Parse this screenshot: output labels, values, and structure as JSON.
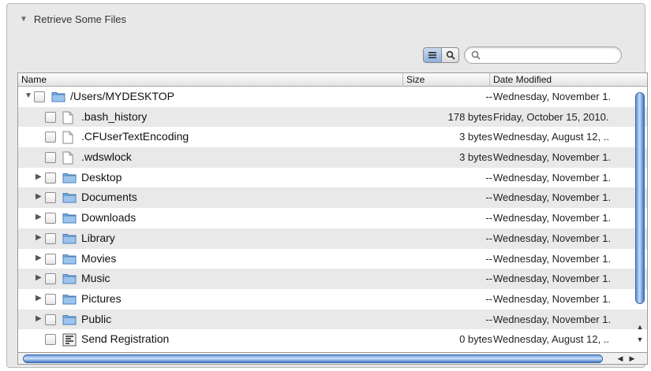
{
  "header": {
    "title": "Retrieve Some Files"
  },
  "toolbar": {
    "search_placeholder": "",
    "list_view_icon": "list-icon",
    "search_view_icon": "magnifier-icon"
  },
  "table": {
    "columns": {
      "name": "Name",
      "size": "Size",
      "date": "Date Modified"
    },
    "rows": [
      {
        "name": "/Users/MYDESKTOP",
        "size": "--",
        "date": "Wednesday, November 1.",
        "type": "folder",
        "expanded": true,
        "indent": 0
      },
      {
        "name": ".bash_history",
        "size": "178 bytes",
        "date": "Friday, October 15, 2010.",
        "type": "file",
        "indent": 1
      },
      {
        "name": ".CFUserTextEncoding",
        "size": "3 bytes",
        "date": "Wednesday, August 12, ..",
        "type": "file",
        "indent": 1
      },
      {
        "name": ".wdswlock",
        "size": "3 bytes",
        "date": "Wednesday, November 1.",
        "type": "file",
        "indent": 1
      },
      {
        "name": "Desktop",
        "size": "--",
        "date": "Wednesday, November 1.",
        "type": "folder",
        "indent": 1
      },
      {
        "name": "Documents",
        "size": "--",
        "date": "Wednesday, November 1.",
        "type": "folder",
        "indent": 1
      },
      {
        "name": "Downloads",
        "size": "--",
        "date": "Wednesday, November 1.",
        "type": "folder",
        "indent": 1
      },
      {
        "name": "Library",
        "size": "--",
        "date": "Wednesday, November 1.",
        "type": "folder",
        "indent": 1
      },
      {
        "name": "Movies",
        "size": "--",
        "date": "Wednesday, November 1.",
        "type": "folder",
        "indent": 1
      },
      {
        "name": "Music",
        "size": "--",
        "date": "Wednesday, November 1.",
        "type": "folder",
        "indent": 1
      },
      {
        "name": "Pictures",
        "size": "--",
        "date": "Wednesday, November 1.",
        "type": "folder",
        "indent": 1
      },
      {
        "name": "Public",
        "size": "--",
        "date": "Wednesday, November 1.",
        "type": "folder",
        "indent": 1
      },
      {
        "name": "Send Registration",
        "size": "0 bytes",
        "date": "Wednesday, August 12, ..",
        "type": "app",
        "indent": 1
      }
    ]
  }
}
